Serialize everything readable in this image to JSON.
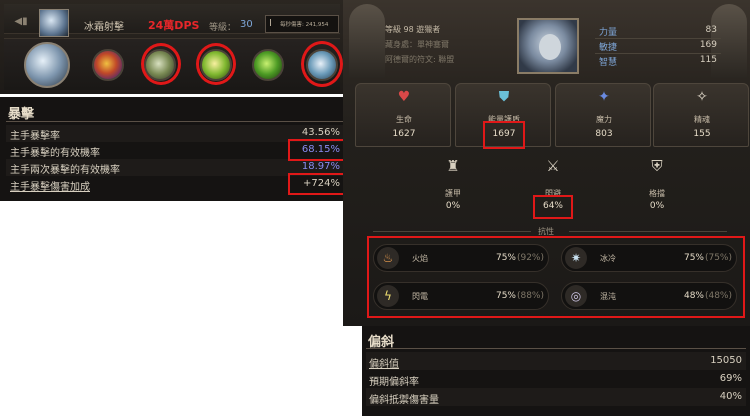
{
  "skill": {
    "name": "冰霜射擊",
    "dps_note": "24萬DPS",
    "level_label": "等級：",
    "level": "30",
    "damage_label": "每秒傷害: 241,954"
  },
  "crit": {
    "title": "暴擊",
    "rows": [
      {
        "label": "主手暴擊率",
        "value": "43.56%"
      },
      {
        "label": "主手暴擊的有效機率",
        "value": "68.15%"
      },
      {
        "label": "主手兩次暴擊的有效機率",
        "value": "18.97%"
      },
      {
        "label": "主手暴擊傷害加成",
        "value": "+724%"
      }
    ],
    "colors": [
      "#d8d0c0",
      "#8a8cf0",
      "#8a8cf0",
      "#d8d0c0"
    ]
  },
  "character": {
    "info": [
      "等級 98 遊獵者",
      "藏身處：單神塞爾",
      "阿德爾的符文: 聯盟"
    ],
    "attributes": [
      {
        "label": "力量",
        "value": "83"
      },
      {
        "label": "敏捷",
        "value": "169"
      },
      {
        "label": "智慧",
        "value": "115"
      }
    ],
    "primary": [
      {
        "label": "生命",
        "value": "1627",
        "icon": "heart-icon"
      },
      {
        "label": "能量護盾",
        "value": "1697",
        "icon": "shield-icon"
      },
      {
        "label": "魔力",
        "value": "803",
        "icon": "mana-icon"
      },
      {
        "label": "精魂",
        "value": "155",
        "icon": "spirit-icon"
      }
    ],
    "defense": [
      {
        "label": "護甲",
        "value": "0%",
        "icon": "armor-icon"
      },
      {
        "label": "閃避",
        "value": "64%",
        "icon": "evasion-icon"
      },
      {
        "label": "格擋",
        "value": "0%",
        "icon": "block-icon"
      }
    ],
    "resist_heading": "抗性",
    "resists": [
      {
        "label": "火焰",
        "value": "75%",
        "max": "(92%)",
        "icon": "fire-icon"
      },
      {
        "label": "冰冷",
        "value": "75%",
        "max": "(75%)",
        "icon": "cold-icon"
      },
      {
        "label": "閃電",
        "value": "75%",
        "max": "(88%)",
        "icon": "lightning-icon"
      },
      {
        "label": "混沌",
        "value": "48%",
        "max": "(48%)",
        "icon": "chaos-icon"
      }
    ]
  },
  "bias": {
    "title": "偏斜",
    "rows": [
      {
        "label": "偏斜值",
        "value": "15050"
      },
      {
        "label": "預期偏斜率",
        "value": "69%"
      },
      {
        "label": "偏斜抵禦傷害量",
        "value": "40%"
      }
    ]
  }
}
